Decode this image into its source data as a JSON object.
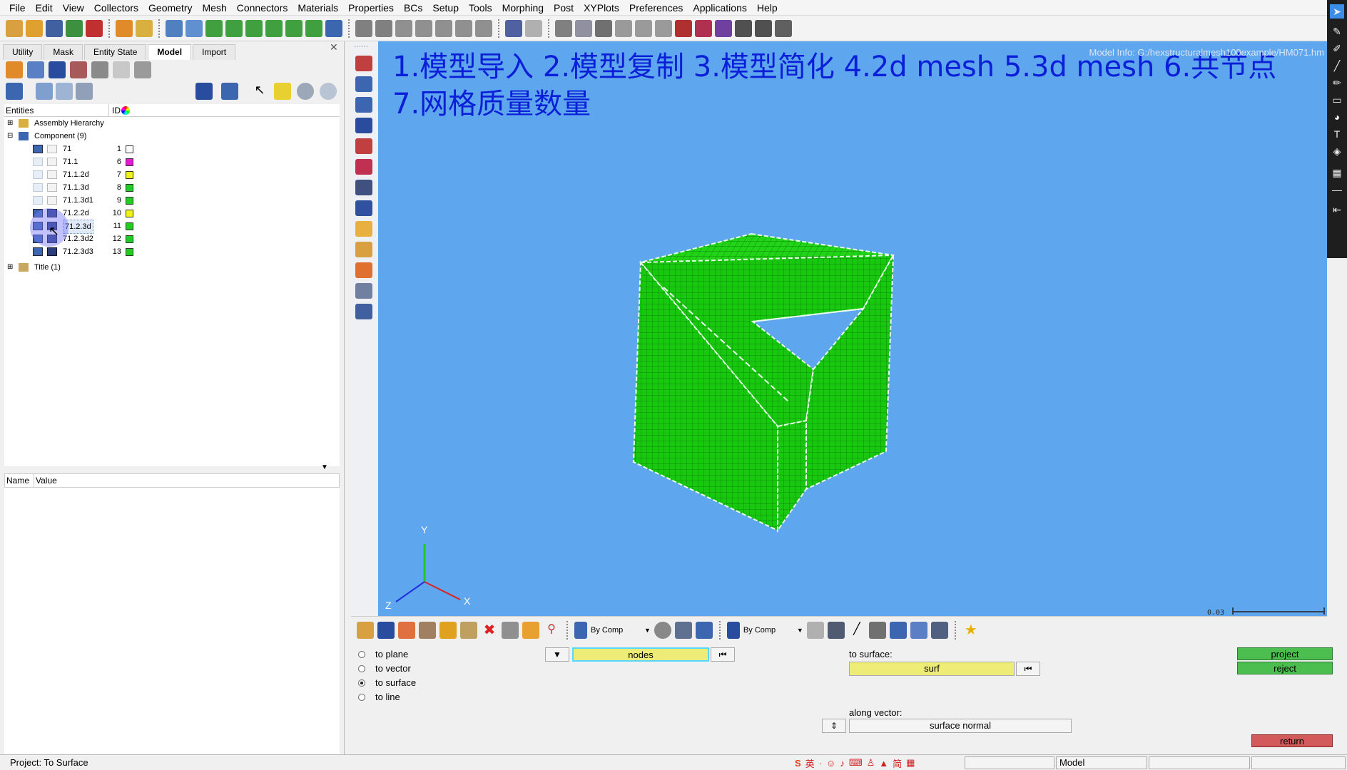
{
  "menu": [
    "File",
    "Edit",
    "View",
    "Collectors",
    "Geometry",
    "Mesh",
    "Connectors",
    "Materials",
    "Properties",
    "BCs",
    "Setup",
    "Tools",
    "Morphing",
    "Post",
    "XYPlots",
    "Preferences",
    "Applications",
    "Help"
  ],
  "tabs": [
    "Utility",
    "Mask",
    "Entity State",
    "Model",
    "Import"
  ],
  "active_tab": "Model",
  "entities_header": {
    "col1": "Entities",
    "col2": "ID"
  },
  "tree": {
    "assembly": "Assembly Hierarchy",
    "component": "Component (9)",
    "rows": [
      {
        "name": "71",
        "id": "1",
        "color": "#ffffff"
      },
      {
        "name": "71.1",
        "id": "6",
        "color": "#e619d2"
      },
      {
        "name": "71.1.2d",
        "id": "7",
        "color": "#f2f21a"
      },
      {
        "name": "71.1.3d",
        "id": "8",
        "color": "#22cc22"
      },
      {
        "name": "71.1.3d1",
        "id": "9",
        "color": "#22cc22"
      },
      {
        "name": "71.2.2d",
        "id": "10",
        "color": "#f2f21a"
      },
      {
        "name": "71.2.3d",
        "id": "11",
        "color": "#22cc22"
      },
      {
        "name": "71.2.3d2",
        "id": "12",
        "color": "#22cc22"
      },
      {
        "name": "71.2.3d3",
        "id": "13",
        "color": "#22cc22"
      }
    ],
    "title": "Title (1)"
  },
  "props_header": {
    "col1": "Name",
    "col2": "Value"
  },
  "viewport": {
    "title_line1": "1.模型导入 2.模型复制 3.模型简化  4.2d mesh 5.3d mesh 6.共节点",
    "title_line2": "7.网格质量数量",
    "model_info": "Model Info: G:/hexstructuralmesh100example/HM071.hm",
    "axis_x": "X",
    "axis_y": "Y",
    "axis_z": "Z",
    "scale": "0.03"
  },
  "bottom_toolbar": {
    "by_comp_1": "By Comp",
    "by_comp_2": "By Comp"
  },
  "panel": {
    "radios": [
      {
        "label": "to plane",
        "checked": false
      },
      {
        "label": "to vector",
        "checked": false
      },
      {
        "label": "to surface",
        "checked": true
      },
      {
        "label": "to line",
        "checked": false
      }
    ],
    "nodes_label": "nodes",
    "to_surface_label": "to surface:",
    "surf_label": "surf",
    "along_vector_label": "along vector:",
    "surface_normal": "surface normal",
    "project_btn": "project",
    "reject_btn": "reject",
    "return_btn": "return"
  },
  "status": {
    "left": "Project: To Surface",
    "model": "Model"
  },
  "colors": {
    "viewport_bg": "#5ea7ef",
    "mesh_green": "#17c80f",
    "title_blue": "#0b1fd8"
  }
}
